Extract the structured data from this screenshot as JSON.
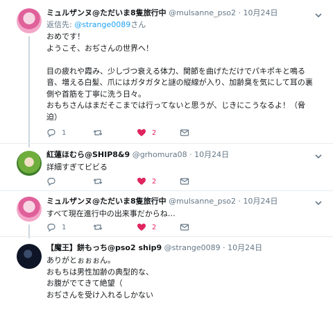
{
  "tweets": [
    {
      "display_name": "ミュルザンヌ@ただいま8隻旅行中",
      "handle": "@mulsanne_pso2",
      "date": "10月24日",
      "reply_to_label": "返信先: ",
      "reply_to_handle": "@strange0089",
      "reply_to_suffix": "さん",
      "lines": [
        "おめです！",
        "ようこそ、おぢさんの世界へ！",
        "",
        "目の疲れや霞み、少しづつ衰える体力、関節を曲げただけでパキポキと鳴る",
        "音、増える白髪、爪にはガタガタと謎の縦線が入り、加齢臭を気にして耳の裏",
        "側や首筋を丁寧に洗う日々。",
        "おもちさんはまだそこまでは行ってないと思うが、じきにこうなるよ！（脅",
        "迫）"
      ],
      "reply_count": "1",
      "retweet_count": "",
      "like_count": "2",
      "liked": true
    },
    {
      "display_name": "紅蓮ほむら@SHIP8&9",
      "handle": "@grhomura08",
      "date": "10月24日",
      "lines": [
        "詳細すぎてビビる"
      ],
      "reply_count": "",
      "retweet_count": "",
      "like_count": "2",
      "liked": true
    },
    {
      "display_name": "ミュルザンヌ@ただいま8隻旅行中",
      "handle": "@mulsanne_pso2",
      "date": "10月24日",
      "lines": [
        "すべて現在進行中の出来事だからね…"
      ],
      "reply_count": "1",
      "retweet_count": "",
      "like_count": "2",
      "liked": true
    },
    {
      "display_name": "【魔王】餅もっち@pso2 ship9",
      "handle": "@strange0089",
      "date": "10月24日",
      "lines": [
        "ありがとぉぉぉん。",
        "おもちは男性加齢の典型的な、",
        "お腹がでてきて絶望（",
        "おぢさんを受け入れるしかない"
      ]
    }
  ],
  "separator": " · ",
  "colors": {
    "like": "#e0245e",
    "link": "#1da1f2",
    "meta": "#657786"
  }
}
